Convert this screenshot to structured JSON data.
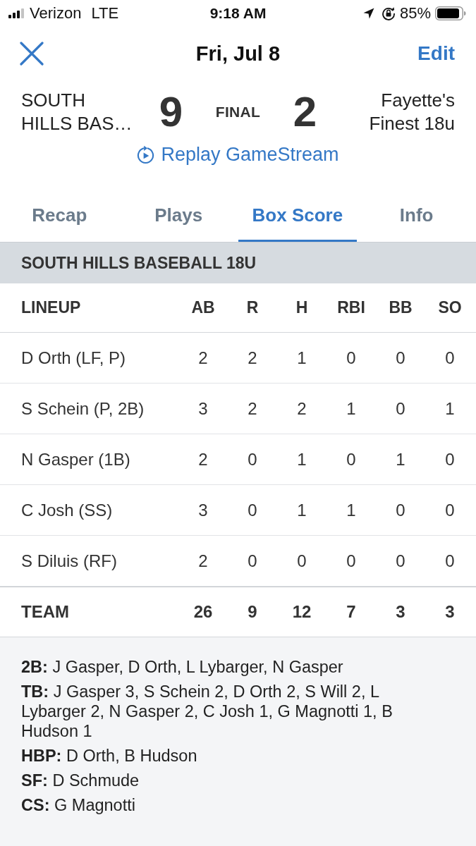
{
  "status_bar": {
    "carrier": "Verizon",
    "network": "LTE",
    "time": "9:18 AM",
    "battery": "85%"
  },
  "nav": {
    "title": "Fri, Jul 8",
    "edit": "Edit"
  },
  "score": {
    "home": {
      "name": "SOUTH HILLS BAS…",
      "score": "9"
    },
    "status": "FINAL",
    "away": {
      "name": "Fayette's Finest 18u",
      "score": "2"
    },
    "replay": "Replay GameStream"
  },
  "tabs": [
    {
      "label": "Recap",
      "selected": false
    },
    {
      "label": "Plays",
      "selected": false
    },
    {
      "label": "Box Score",
      "selected": true
    },
    {
      "label": "Info",
      "selected": false
    }
  ],
  "box_score": {
    "team": "SOUTH HILLS BASEBALL 18U",
    "columns": [
      "LINEUP",
      "AB",
      "R",
      "H",
      "RBI",
      "BB",
      "SO"
    ],
    "rows": [
      {
        "cells": [
          "D Orth (LF, P)",
          "2",
          "2",
          "1",
          "0",
          "0",
          "0"
        ]
      },
      {
        "cells": [
          "S Schein (P, 2B)",
          "3",
          "2",
          "2",
          "1",
          "0",
          "1"
        ]
      },
      {
        "cells": [
          "N Gasper (1B)",
          "2",
          "0",
          "1",
          "0",
          "1",
          "0"
        ]
      },
      {
        "cells": [
          "C Josh (SS)",
          "3",
          "0",
          "1",
          "1",
          "0",
          "0"
        ]
      },
      {
        "cells": [
          "S Diluis (RF)",
          "2",
          "0",
          "0",
          "0",
          "0",
          "0"
        ]
      }
    ],
    "total": [
      "TEAM",
      "26",
      "9",
      "12",
      "7",
      "3",
      "3"
    ]
  },
  "notes": [
    "**2B:** J Gasper, D Orth, L Lybarger, N Gasper",
    "**TB:** J Gasper 3, S Schein 2, D Orth 2, S Will 2, L Lybarger 2, N Gasper 2, C Josh 1, G Magnotti 1, B Hudson 1",
    "**HBP:** D Orth, B Hudson",
    "**SF:** D Schmude",
    "**CS:** G Magnotti"
  ]
}
